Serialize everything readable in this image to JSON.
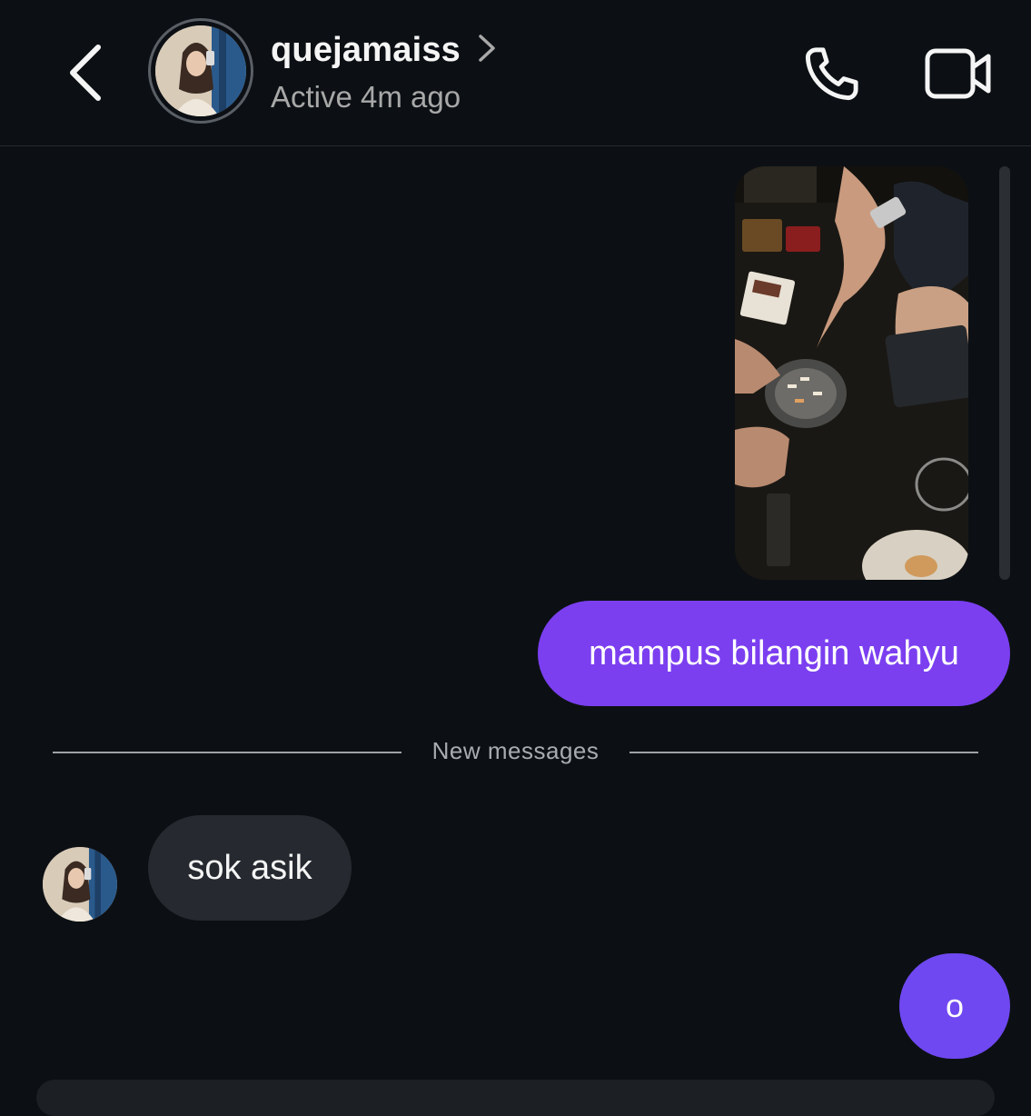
{
  "header": {
    "back_icon": "chevron-left-icon",
    "profile_name": "quejamaiss",
    "profile_chevron_icon": "chevron-right-icon",
    "status": "Active 4m ago",
    "call_icon": "phone-icon",
    "video_icon": "video-camera-icon"
  },
  "thread": {
    "partial_caption": "",
    "messages": [
      {
        "type": "photo",
        "sender": "me",
        "description_icon": "photo-message"
      },
      {
        "type": "text",
        "sender": "me",
        "text": "mampus bilangin wahyu"
      },
      {
        "type": "divider",
        "label": "New messages"
      },
      {
        "type": "text",
        "sender": "them",
        "text": "sok asik"
      },
      {
        "type": "text",
        "sender": "me",
        "text": "o"
      }
    ]
  },
  "colors": {
    "background": "#0c1014",
    "outgoing_bubble": "#7b3ff0",
    "outgoing_bubble_alt": "#6f48f1",
    "incoming_bubble": "#262a30",
    "muted_text": "#a8a8a8"
  }
}
